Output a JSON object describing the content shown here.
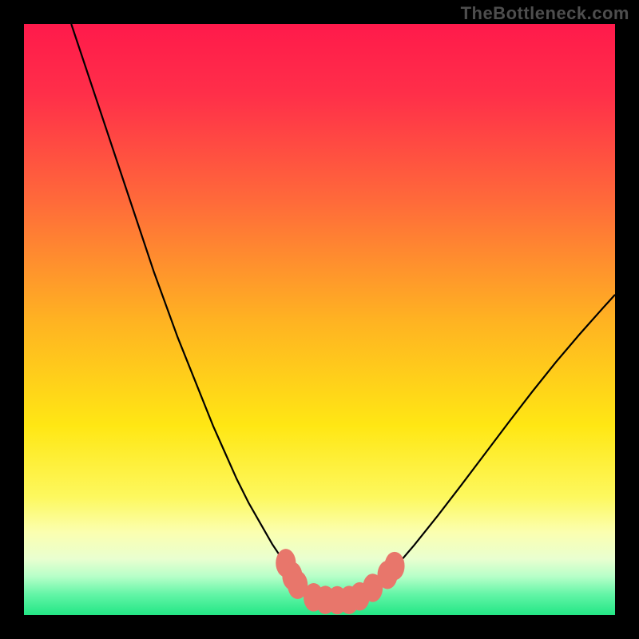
{
  "watermark": "TheBottleneck.com",
  "chart_data": {
    "type": "line",
    "title": "",
    "xlabel": "",
    "ylabel": "",
    "xlim": [
      0,
      100
    ],
    "ylim": [
      0,
      100
    ],
    "background": {
      "type": "vertical-gradient",
      "stops": [
        {
          "pos": 0.0,
          "color": "#ff1a4b"
        },
        {
          "pos": 0.12,
          "color": "#ff2f49"
        },
        {
          "pos": 0.3,
          "color": "#ff6a3a"
        },
        {
          "pos": 0.5,
          "color": "#ffb222"
        },
        {
          "pos": 0.68,
          "color": "#ffe714"
        },
        {
          "pos": 0.8,
          "color": "#fdf85e"
        },
        {
          "pos": 0.86,
          "color": "#fbffb0"
        },
        {
          "pos": 0.905,
          "color": "#e9ffd0"
        },
        {
          "pos": 0.935,
          "color": "#b6ffc8"
        },
        {
          "pos": 0.965,
          "color": "#63f5a7"
        },
        {
          "pos": 1.0,
          "color": "#23e685"
        }
      ]
    },
    "series": [
      {
        "name": "bottleneck-curve",
        "color": "#000000",
        "x": [
          8,
          10,
          12,
          14,
          16,
          18,
          20,
          22,
          24,
          26,
          28,
          30,
          32,
          34,
          36,
          38,
          40,
          42,
          44,
          45,
          46,
          48,
          50,
          52,
          54,
          56,
          57,
          58,
          60,
          63,
          66,
          70,
          74,
          78,
          82,
          86,
          90,
          94,
          98,
          100
        ],
        "y": [
          100,
          94,
          88,
          82,
          76,
          70,
          64,
          58,
          52.5,
          47,
          42,
          37,
          32,
          27.5,
          23,
          19,
          15.5,
          12,
          9,
          7.6,
          6.3,
          4.4,
          3.2,
          2.6,
          2.5,
          2.8,
          3.2,
          3.8,
          5.4,
          8.3,
          11.8,
          16.8,
          22,
          27.3,
          32.6,
          37.8,
          42.8,
          47.5,
          52,
          54.2
        ]
      }
    ],
    "markers": {
      "color": "#e8766b",
      "rx": 1.7,
      "ry": 2.4,
      "points": [
        {
          "x": 44.3,
          "y": 8.8
        },
        {
          "x": 45.4,
          "y": 6.6
        },
        {
          "x": 46.3,
          "y": 5.1
        },
        {
          "x": 49.0,
          "y": 3.0
        },
        {
          "x": 51.0,
          "y": 2.55
        },
        {
          "x": 53.0,
          "y": 2.5
        },
        {
          "x": 55.0,
          "y": 2.55
        },
        {
          "x": 56.8,
          "y": 3.15
        },
        {
          "x": 59.0,
          "y": 4.6
        },
        {
          "x": 61.5,
          "y": 6.8
        },
        {
          "x": 62.7,
          "y": 8.3
        }
      ]
    }
  }
}
